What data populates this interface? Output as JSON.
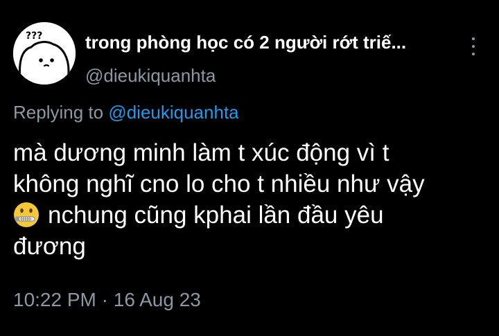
{
  "tweet": {
    "display_name": "trong phòng học có 2 người rớt triế...",
    "username": "@dieukiquanhta",
    "reply": {
      "prefix": "Replying to",
      "handle": "@dieukiquanhta"
    },
    "body": {
      "line1": "mà dương minh làm t xúc động vì t",
      "line2": "không nghĩ cno lo cho t nhiều như vậy",
      "emoji": "zipper-mouth-face",
      "line3": "nchung cũng kphai lần đầu yêu",
      "line4": "đương"
    },
    "time": "10:22 PM",
    "separator": "·",
    "date": "16 Aug 23"
  },
  "colors": {
    "background": "#000000",
    "text": "#ffffff",
    "secondary": "#8b98a5",
    "link": "#1d9bf0",
    "emoji_face": "#f5c83a"
  },
  "icons": {
    "avatar": "blob-with-question-marks",
    "more": "more-vertical-icon"
  }
}
